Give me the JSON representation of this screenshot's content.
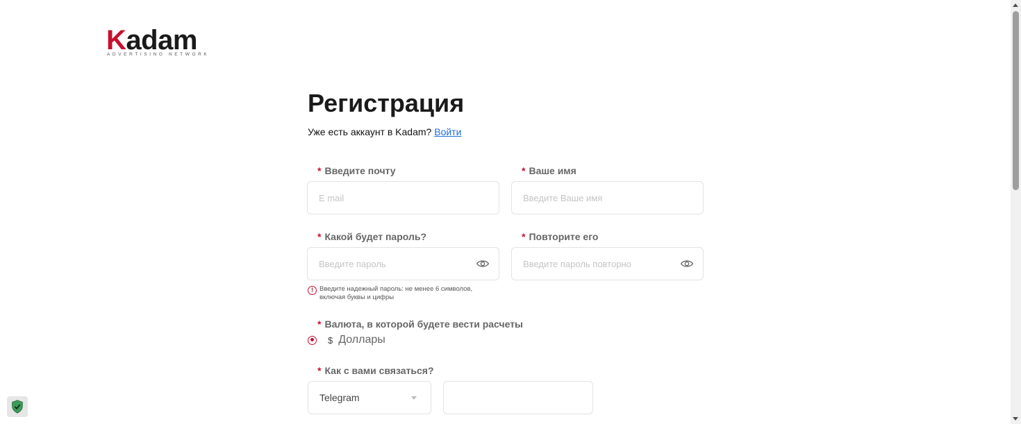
{
  "logo": {
    "brand": "Kadam",
    "tagline": "ADVERTISING NETWORK"
  },
  "page": {
    "title": "Регистрация",
    "login_prompt": "Уже есть аккаунт в Kadam?",
    "login_link": "Войти"
  },
  "form": {
    "email": {
      "label": "Введите почту",
      "placeholder": "E mail",
      "value": ""
    },
    "name": {
      "label": "Ваше имя",
      "placeholder": "Введите Ваше имя",
      "value": ""
    },
    "password": {
      "label": "Какой будет пароль?",
      "placeholder": "Введите пароль",
      "value": ""
    },
    "password_repeat": {
      "label": "Повторите его",
      "placeholder": "Введите пароль повторно",
      "value": ""
    },
    "password_hint": "Введите надежный пароль: не менее 6 символов, включая буквы и цифры",
    "currency": {
      "label": "Валюта, в которой будете вести расчеты",
      "symbol": "$",
      "option": "Доллары",
      "selected": true
    },
    "contact": {
      "label": "Как с вами связаться?",
      "method": "Telegram",
      "value": ""
    },
    "required_mark": "*"
  },
  "colors": {
    "accent": "#c8102e",
    "link": "#1e6fd9"
  },
  "icons": [
    "eye-icon",
    "warning-icon",
    "chevron-down-icon",
    "shield-icon"
  ]
}
